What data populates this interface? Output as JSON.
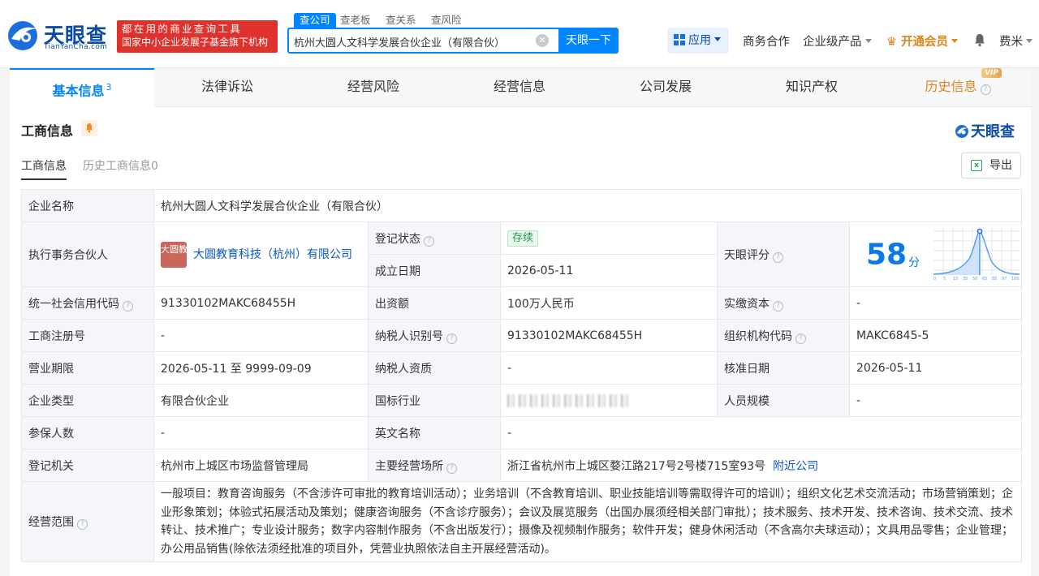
{
  "header": {
    "logo_text": "天眼查",
    "logo_sub": "TianYanCha.com",
    "slogan_line1": "都在用的商业查询工具",
    "slogan_line2": "国家中小企业发展子基金旗下机构",
    "search_tabs": [
      "查公司",
      "查老板",
      "查关系",
      "查风险"
    ],
    "search_value": "杭州大圆人文科学发展合伙企业（有限合伙）",
    "search_button": "天眼一下",
    "app_label": "应用",
    "nav": [
      "商务合作",
      "企业级产品",
      "开通会员"
    ],
    "user": "费米"
  },
  "tabs": {
    "items": [
      "基本信息",
      "法律诉讼",
      "经营风险",
      "经营信息",
      "公司发展",
      "知识产权",
      "历史信息"
    ],
    "active_count": "3",
    "vip_badge": "VIP"
  },
  "section": {
    "title": "工商信息",
    "brand": "天眼查",
    "subtab_current": "工商信息",
    "subtab_history": "历史工商信息0",
    "export": "导出"
  },
  "info": {
    "company_name_label": "企业名称",
    "company_name": "杭州大圆人文科学发展合伙企业（有限合伙）",
    "partner_label": "执行事务合伙人",
    "partner_logo": "大圆教育",
    "partner": "大圆教育科技（杭州）有限公司",
    "status_label": "登记状态",
    "status": "存续",
    "found_date_label": "成立日期",
    "found_date": "2026-05-11",
    "score_label": "天眼评分",
    "score": "58",
    "score_unit": "分",
    "score_ticks": [
      "0",
      "5",
      "15",
      "35",
      "50",
      "65",
      "85",
      "97",
      "100"
    ],
    "credit_code_label": "统一社会信用代码",
    "credit_code": "91330102MAKC68455H",
    "capital_label": "出资额",
    "capital": "100万人民币",
    "paid_capital_label": "实缴资本",
    "paid_capital": "-",
    "reg_no_label": "工商注册号",
    "reg_no": "-",
    "taxpayer_id_label": "纳税人识别号",
    "taxpayer_id": "91330102MAKC68455H",
    "org_code_label": "组织机构代码",
    "org_code": "MAKC6845-5",
    "term_label": "营业期限",
    "term": "2026-05-11 至 9999-09-09",
    "taxpayer_qual_label": "纳税人资质",
    "taxpayer_qual": "-",
    "approve_date_label": "核准日期",
    "approve_date": "2026-05-11",
    "type_label": "企业类型",
    "type": "有限合伙企业",
    "industry_label": "国标行业",
    "staff_label": "人员规模",
    "staff": "-",
    "insured_label": "参保人数",
    "insured": "-",
    "english_name_label": "英文名称",
    "english_name": "-",
    "authority_label": "登记机关",
    "authority": "杭州市上城区市场监督管理局",
    "address_label": "主要经营场所",
    "address": "浙江省杭州市上城区婺江路217号2号楼715室93号",
    "nearby_link": "附近公司",
    "scope_label": "经营范围",
    "scope": "一般项目：教育咨询服务（不含涉许可审批的教育培训活动）；业务培训（不含教育培训、职业技能培训等需取得许可的培训）；组织文化艺术交流活动；市场营销策划；企业形象策划；体验式拓展活动及策划；健康咨询服务（不含诊疗服务）；会议及展览服务（出国办展须经相关部门审批）；技术服务、技术开发、技术咨询、技术交流、技术转让、技术推广；专业设计服务；数字内容制作服务（不含出版发行）；摄像及视频制作服务；软件开发；健身休闲活动（不含高尔夫球运动）；文具用品零售；企业管理；办公用品销售(除依法须经批准的项目外，凭营业执照依法自主开展经营活动)。"
  },
  "colors": {
    "accent": "#0084ff",
    "brand": "#0a4aa8",
    "slogan_bg": "#e0322d",
    "vip": "#d9861a"
  }
}
